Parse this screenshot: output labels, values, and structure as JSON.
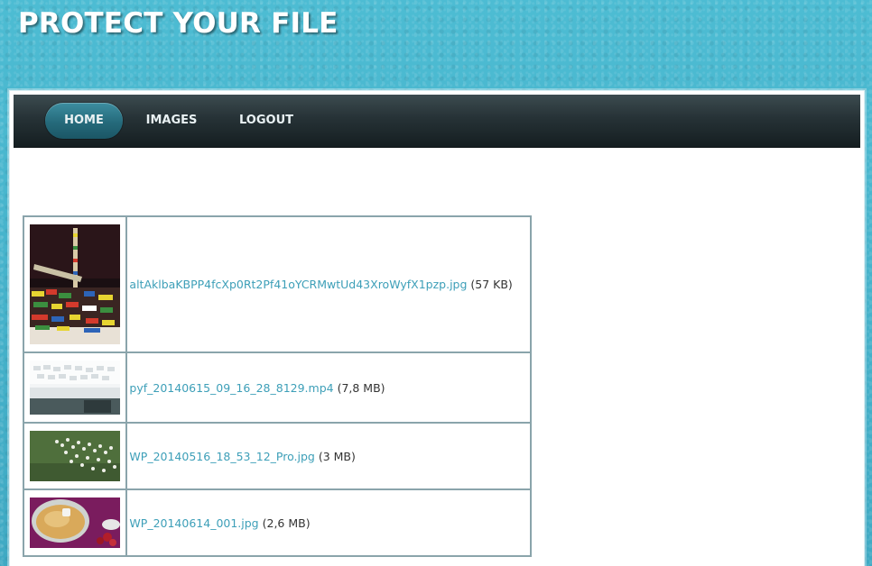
{
  "header": {
    "title": "PROTECT YOUR FILE"
  },
  "nav": {
    "items": [
      {
        "label": "HOME",
        "active": true
      },
      {
        "label": "IMAGES",
        "active": false
      },
      {
        "label": "LOGOUT",
        "active": false
      }
    ]
  },
  "files": [
    {
      "name": "altAklbaKBPP4fcXp0Rt2Pf41oYCRMwtUd43XroWyfX1pzp.jpg",
      "size": "(57 KB)",
      "thumb": "lego-tower-photo"
    },
    {
      "name": "pyf_20140615_09_16_28_8129.mp4",
      "size": "(7,8 MB)",
      "thumb": "keyboard-photo"
    },
    {
      "name": "WP_20140516_18_53_12_Pro.jpg",
      "size": "(3 MB)",
      "thumb": "birds-on-grass-photo"
    },
    {
      "name": "WP_20140614_001.jpg",
      "size": "(2,6 MB)",
      "thumb": "food-dish-photo"
    }
  ],
  "colors": {
    "background": "#47b3cc",
    "nav_dark": "#1c2528",
    "nav_active": "#2a7384",
    "link": "#3d9fb8",
    "table_border": "#8aa4ab"
  }
}
